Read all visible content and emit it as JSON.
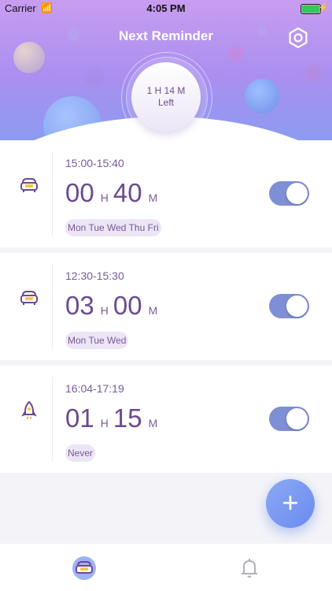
{
  "status_bar": {
    "carrier": "Carrier",
    "time": "4:05 PM"
  },
  "header": {
    "title": "Next Reminder",
    "countdown_line1": "1 H 14 M",
    "countdown_line2": "Left"
  },
  "reminders": [
    {
      "icon": "sofa-icon",
      "range": "15:00-15:40",
      "hours": "00",
      "hour_unit": "H",
      "minutes": "40",
      "minute_unit": "M",
      "days": "Mon Tue Wed Thu Fri",
      "enabled": true
    },
    {
      "icon": "sofa-icon",
      "range": "12:30-15:30",
      "hours": "03",
      "hour_unit": "H",
      "minutes": "00",
      "minute_unit": "M",
      "days": "Mon Tue Wed",
      "enabled": true
    },
    {
      "icon": "rocket-icon",
      "range": "16:04-17:19",
      "hours": "01",
      "hour_unit": "H",
      "minutes": "15",
      "minute_unit": "M",
      "days": "Never",
      "enabled": true
    }
  ],
  "fab": {
    "label": "+"
  },
  "colors": {
    "accent": "#7f8fd6",
    "text": "#6b4a8e",
    "header_top": "#c89df0",
    "header_bottom": "#8c9bf0"
  }
}
